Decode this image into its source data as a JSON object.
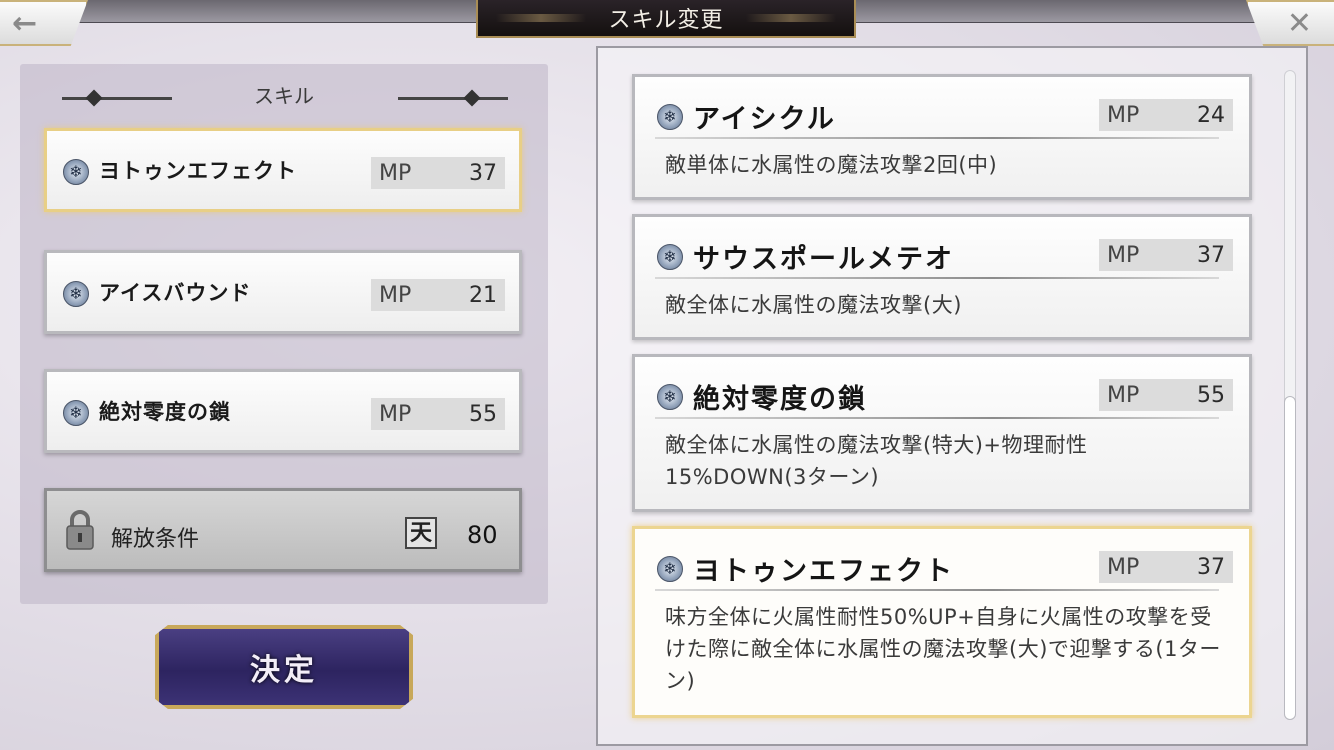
{
  "header": {
    "title": "スキル変更",
    "back_icon": "←",
    "close_icon": "✕"
  },
  "left": {
    "section_title": "スキル",
    "skills": [
      {
        "name": "ヨトゥンエフェクト",
        "mp_label": "MP",
        "mp": "37",
        "selected": true
      },
      {
        "name": "アイスバウンド",
        "mp_label": "MP",
        "mp": "21",
        "selected": false
      },
      {
        "name": "絶対零度の鎖",
        "mp_label": "MP",
        "mp": "55",
        "selected": false
      }
    ],
    "unlock": {
      "label": "解放条件",
      "icon_glyph": "天",
      "value": "80"
    },
    "decide_label": "決定"
  },
  "right": {
    "skills": [
      {
        "name": "アイシクル",
        "mp_label": "MP",
        "mp": "24",
        "desc": "敵単体に水属性の魔法攻撃2回(中)"
      },
      {
        "name": "サウスポールメテオ",
        "mp_label": "MP",
        "mp": "37",
        "desc": "敵全体に水属性の魔法攻撃(大)"
      },
      {
        "name": "絶対零度の鎖",
        "mp_label": "MP",
        "mp": "55",
        "desc": "敵全体に水属性の魔法攻撃(特大)+物理耐性15%DOWN(3ターン)"
      },
      {
        "name": "ヨトゥンエフェクト",
        "mp_label": "MP",
        "mp": "37",
        "desc": "味方全体に火属性耐性50%UP+自身に火属性の攻撃を受けた際に敵全体に水属性の魔法攻撃(大)で迎撃する(1ターン)"
      }
    ]
  },
  "icons": {
    "skill": "snowflake-icon",
    "lock": "lock-icon",
    "unlock_currency": "ten-icon"
  },
  "colors": {
    "selected_border": "#e8cf86",
    "decide_bg": "#2d2460",
    "title_bg": "#1a1515"
  }
}
